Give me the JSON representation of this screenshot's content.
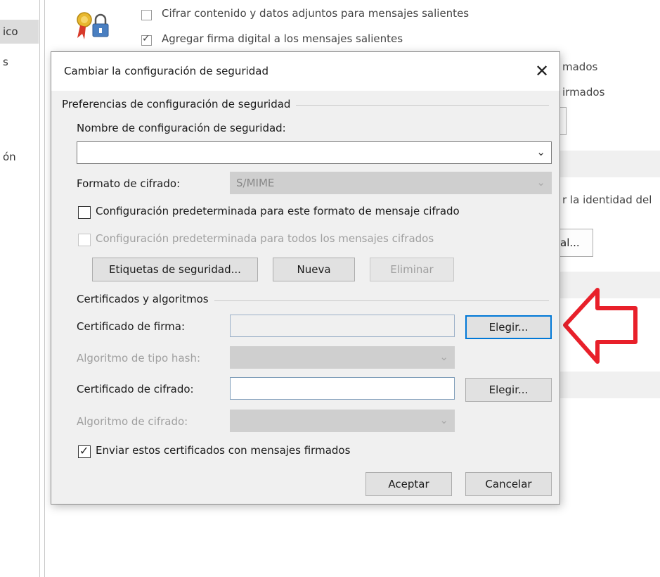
{
  "background": {
    "nav": {
      "item1": "ico",
      "item2": "s",
      "item3": "ón"
    },
    "options": {
      "encrypt_label_pre": "Cifrar contenido y datos adjuntos para mensajes salientes",
      "sign_label": "Agregar firma digital a los mensajes salientes"
    },
    "right_text": {
      "line1": "mados",
      "line2": "irmados",
      "identity": "r la identidad del",
      "button": "al..."
    }
  },
  "dialog": {
    "title": "Cambiar la configuración de seguridad",
    "close_glyph": "✕",
    "prefs_group": "Preferencias de configuración de seguridad",
    "setting_name_label": "Nombre de configuración de seguridad:",
    "setting_name_value": "",
    "format_label": "Formato de cifrado:",
    "format_value": "S/MIME",
    "default_format_cb": {
      "label": "Configuración predeterminada para este formato de mensaje cifrado",
      "checked": false
    },
    "default_all_cb": {
      "label": "Configuración predeterminada para todos los mensajes cifrados",
      "checked": false,
      "disabled": true
    },
    "buttons": {
      "labels": "Etiquetas de seguridad...",
      "new": "Nueva",
      "delete": "Eliminar"
    },
    "certs_group": "Certificados y algoritmos",
    "sign_cert_label": "Certificado de firma:",
    "choose1": "Elegir...",
    "hash_label": "Algoritmo de tipo hash:",
    "enc_cert_label": "Certificado de cifrado:",
    "choose2": "Elegir...",
    "enc_alg_label": "Algoritmo de cifrado:",
    "send_certs_cb": {
      "label": "Enviar estos certificados con mensajes firmados",
      "checked": true
    },
    "ok": "Aceptar",
    "cancel": "Cancelar"
  },
  "annotation": {
    "color": "#e8202a",
    "shape": "arrow-left"
  },
  "colors": {
    "accent": "#0078d7",
    "dialog_bg": "#f0f0f0"
  }
}
